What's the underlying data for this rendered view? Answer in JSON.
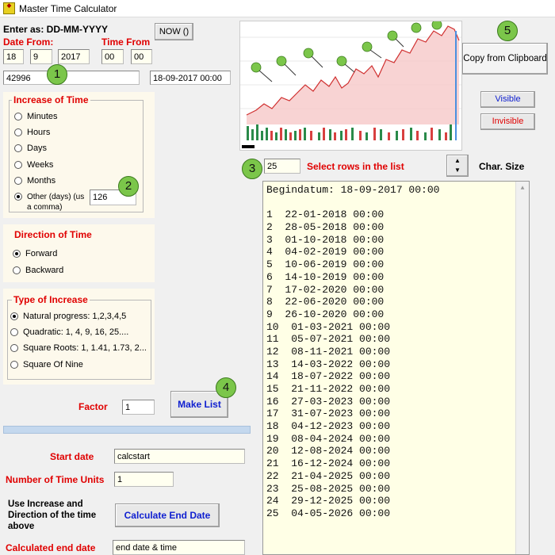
{
  "window": {
    "title": "Master Time Calculator"
  },
  "date_input": {
    "format_label": "Enter as: DD-MM-YYYY",
    "date_from_label": "Date From:",
    "time_from_label": "Time From",
    "now_button": "NOW ()",
    "day": "18",
    "month": "9",
    "year": "2017",
    "hour": "00",
    "minute": "00",
    "serial": "42996",
    "datetime": "18-09-2017 00:00"
  },
  "markers": {
    "m1": "1",
    "m2": "2",
    "m3": "3",
    "m4": "4",
    "m5": "5"
  },
  "increase": {
    "label": "Increase of Time",
    "options": [
      "Minutes",
      "Hours",
      "Days",
      "Weeks",
      "Months",
      "Other (days) (us a comma)"
    ],
    "selected": "Other (days) (us a comma)",
    "other_value": "126"
  },
  "direction": {
    "label": "Direction of Time",
    "options": [
      "Forward",
      "Backward"
    ],
    "selected": "Forward"
  },
  "increase_type": {
    "label": "Type of Increase",
    "options": [
      "Natural progress: 1,2,3,4,5",
      "Quadratic: 1, 4, 9, 16, 25....",
      "Square Roots: 1, 1.41, 1.73, 2...",
      "Square Of Nine"
    ],
    "selected": "Natural progress: 1,2,3,4,5"
  },
  "factor": {
    "label": "Factor",
    "value": "1"
  },
  "make_list_button": "Make List",
  "calc": {
    "start_date_label": "Start date",
    "start_date_value": "calcstart",
    "units_label": "Number of Time Units",
    "units_value": "1",
    "use_label": "Use Increase and Direction of the time above",
    "calc_button": "Calculate End Date",
    "end_label": "Calculated end date",
    "end_value": "end date & time"
  },
  "right": {
    "copy_button": "Copy from Clipboard",
    "visible_button": "Visible",
    "invisible_button": "Invisible",
    "rows_value": "25",
    "rows_label": "Select rows in the list",
    "char_size_label": "Char. Size"
  },
  "list": {
    "header": "Begindatum: 18-09-2017 00:00",
    "rows": [
      "1  22-01-2018 00:00",
      "2  28-05-2018 00:00",
      "3  01-10-2018 00:00",
      "4  04-02-2019 00:00",
      "5  10-06-2019 00:00",
      "6  14-10-2019 00:00",
      "7  17-02-2020 00:00",
      "8  22-06-2020 00:00",
      "9  26-10-2020 00:00",
      "10  01-03-2021 00:00",
      "11  05-07-2021 00:00",
      "12  08-11-2021 00:00",
      "13  14-03-2022 00:00",
      "14  18-07-2022 00:00",
      "15  21-11-2022 00:00",
      "16  27-03-2023 00:00",
      "17  31-07-2023 00:00",
      "18  04-12-2023 00:00",
      "19  08-04-2024 00:00",
      "20  12-08-2024 00:00",
      "21  16-12-2024 00:00",
      "22  21-04-2025 00:00",
      "23  25-08-2025 00:00",
      "24  29-12-2025 00:00",
      "25  04-05-2026 00:00"
    ]
  },
  "colors": {
    "accent_red": "#e00000",
    "marker_green": "#7bc64a",
    "field_bg": "#fffff0",
    "list_bg": "#ffffe6",
    "panel_bg": "#fdf9ec"
  }
}
